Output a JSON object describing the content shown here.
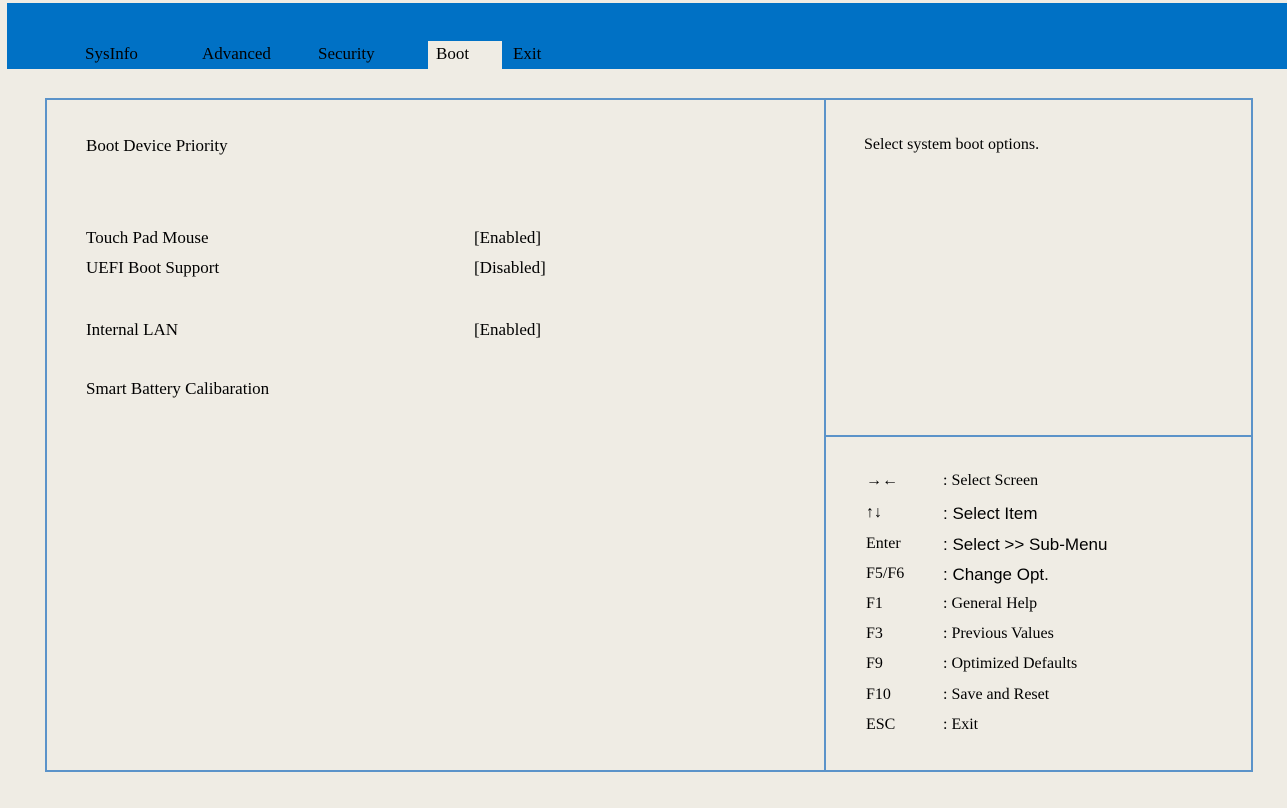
{
  "tabs": [
    "SysInfo",
    "Advanced",
    "Security",
    "Boot",
    "Exit"
  ],
  "active_tab": "Boot",
  "main": {
    "boot_device_priority": "Boot Device Priority",
    "touch_pad_mouse": {
      "label": "Touch Pad Mouse",
      "value": "[Enabled]"
    },
    "uefi_boot_support": {
      "label": "UEFI Boot Support",
      "value": "[Disabled]"
    },
    "internal_lan": {
      "label": "Internal LAN",
      "value": "[Enabled]"
    },
    "smart_battery_calibration": "Smart Battery Calibaration"
  },
  "help": {
    "text": "Select system boot options."
  },
  "legend": [
    {
      "key": "→←",
      "desc": ": Select Screen"
    },
    {
      "key": "↑↓",
      "desc": ": Select Item"
    },
    {
      "key": "Enter",
      "desc": ": Select >> Sub-Menu"
    },
    {
      "key": "F5/F6",
      "desc": ": Change Opt."
    },
    {
      "key": "F1",
      "desc": ": General Help"
    },
    {
      "key": "F3",
      "desc": ": Previous Values"
    },
    {
      "key": "F9",
      "desc": ": Optimized Defaults"
    },
    {
      "key": "F10",
      "desc": ": Save and Reset"
    },
    {
      "key": "ESC",
      "desc": ": Exit"
    }
  ],
  "colors": {
    "header_blue": "#0071c5",
    "background": "#efece4",
    "border_blue": "#5b93c9"
  }
}
